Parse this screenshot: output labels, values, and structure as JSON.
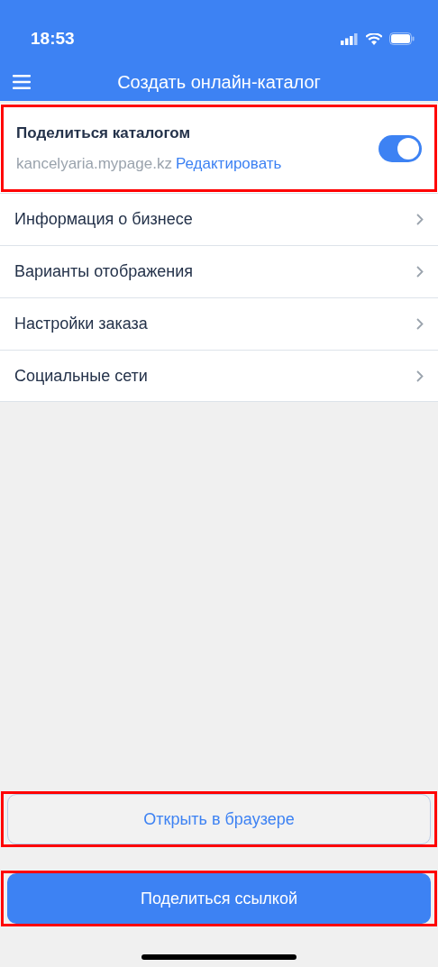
{
  "status_bar": {
    "time": "18:53"
  },
  "nav_bar": {
    "title": "Создать онлайн-каталог"
  },
  "share": {
    "title": "Поделиться каталогом",
    "url": "kancelyaria.mypage.kz",
    "edit_link": "Редактировать",
    "on": true,
    "highlighted": true
  },
  "menu_items": [
    {
      "label": "Информация о бизнесе"
    },
    {
      "label": "Варианты отображения"
    },
    {
      "label": "Настройки заказа"
    },
    {
      "label": "Социальные сети"
    }
  ],
  "buttons": [
    {
      "kind": "outline",
      "label": "Открыть в браузере",
      "highlighted": true
    },
    {
      "kind": "primary",
      "label": "Поделиться ссылкой",
      "highlighted": true
    }
  ]
}
